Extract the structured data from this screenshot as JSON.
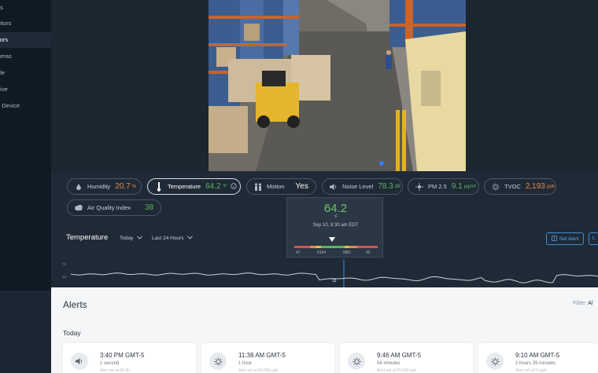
{
  "sidebar": {
    "items": [
      {
        "label": "ds",
        "active": false
      },
      {
        "label": "nitors",
        "active": false
      },
      {
        "label": "sors",
        "active": true
      },
      {
        "label": "neras",
        "active": false
      },
      {
        "label": "ple",
        "active": false
      },
      {
        "label": "hive",
        "active": false
      },
      {
        "label": "d Device",
        "active": false
      }
    ]
  },
  "sensors": {
    "humidity": {
      "label": "Humidity",
      "value": "20.7",
      "unit": "%"
    },
    "temperature": {
      "label": "Temperature",
      "value": "64.2",
      "unit": "°F"
    },
    "motion": {
      "label": "Motion",
      "value": "Yes"
    },
    "noise": {
      "label": "Noise Level",
      "value": "78.3",
      "unit": "dB"
    },
    "pm25": {
      "label": "PM 2.5",
      "value": "9.1",
      "unit": "μg/m³"
    },
    "tvoc": {
      "label": "TVOC",
      "value": "2,193",
      "unit": "ppb"
    },
    "aqi": {
      "label": "Air Quality Index",
      "value": "38"
    }
  },
  "tooltip": {
    "value": "64.2",
    "unit": "°F",
    "date": "Sep 10, 8:30 am EDT",
    "ticks": [
      "47",
      "6164",
      "7881",
      "92"
    ],
    "marker_fraction": 0.45
  },
  "chart": {
    "title": "Temperature",
    "range_select": "Today",
    "period_select": "Last 24 Hours",
    "set_alert": "Set Alert",
    "extra_button": "L",
    "y_ticks": [
      "75",
      "63"
    ]
  },
  "alerts": {
    "title": "Alerts",
    "filter_label": "Filter:",
    "filter_value": "Al",
    "group": "Today",
    "cards": [
      {
        "icon": "speaker-icon",
        "time": "3:40 PM GMT-5",
        "duration": "1 second",
        "note": "Alert set at 80 db"
      },
      {
        "icon": "sun-icon",
        "time": "11:38 AM GMT-5",
        "duration": "1 hour",
        "note": "Alert set at 60,000 ppb"
      },
      {
        "icon": "sun-icon",
        "time": "9:46 AM GMT-5",
        "duration": "54 minutes",
        "note": "Alert set at 60,000 ppb"
      },
      {
        "icon": "sun-icon",
        "time": "9:10 AM GMT-5",
        "duration": "2 hours 39 minutes",
        "note": "Alert set at % ppb"
      }
    ]
  },
  "colors": {
    "accent": "#3f8fd6",
    "good": "#5bb55d",
    "warn": "#e98a44",
    "sidebar_bg": "#0f1a25"
  }
}
